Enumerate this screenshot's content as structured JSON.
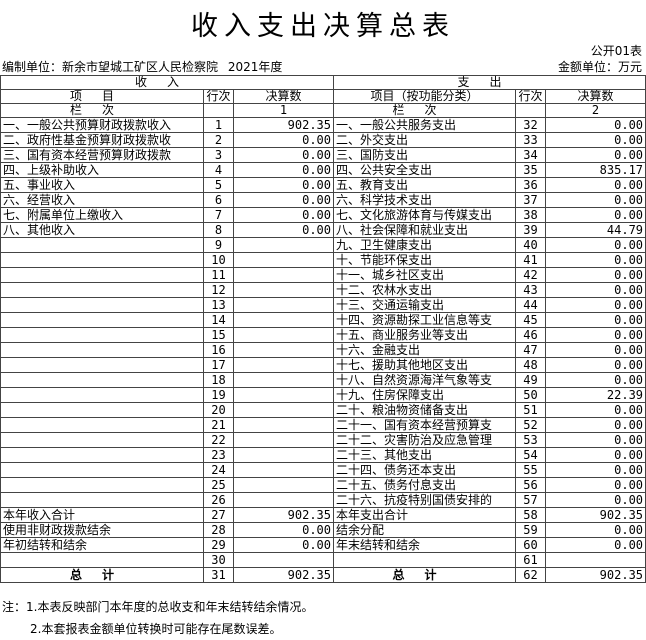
{
  "title": "收入支出决算总表",
  "form_code": "公开01表",
  "unit_label": "编制单位：新余市望城工矿区人民检察院",
  "year": "2021年度",
  "amount_unit": "金额单位：万元",
  "header": {
    "income_section": "收入",
    "expense_section": "支出",
    "item": "项目",
    "row_no": "行次",
    "amount": "决算数",
    "item_by_function": "项目（按功能分类）",
    "column": "栏次",
    "col1": "1",
    "col2": "2"
  },
  "rows": [
    {
      "l_item": "一、一般公共预算财政拨款收入",
      "l_no": "1",
      "l_amt": "902.35",
      "r_item": "一、一般公共服务支出",
      "r_no": "32",
      "r_amt": "0.00"
    },
    {
      "l_item": "二、政府性基金预算财政拨款收",
      "l_no": "2",
      "l_amt": "0.00",
      "r_item": "二、外交支出",
      "r_no": "33",
      "r_amt": "0.00"
    },
    {
      "l_item": "三、国有资本经营预算财政拨款",
      "l_no": "3",
      "l_amt": "0.00",
      "r_item": "三、国防支出",
      "r_no": "34",
      "r_amt": "0.00"
    },
    {
      "l_item": "四、上级补助收入",
      "l_no": "4",
      "l_amt": "0.00",
      "r_item": "四、公共安全支出",
      "r_no": "35",
      "r_amt": "835.17"
    },
    {
      "l_item": "五、事业收入",
      "l_no": "5",
      "l_amt": "0.00",
      "r_item": "五、教育支出",
      "r_no": "36",
      "r_amt": "0.00"
    },
    {
      "l_item": "六、经营收入",
      "l_no": "6",
      "l_amt": "0.00",
      "r_item": "六、科学技术支出",
      "r_no": "37",
      "r_amt": "0.00"
    },
    {
      "l_item": "七、附属单位上缴收入",
      "l_no": "7",
      "l_amt": "0.00",
      "r_item": "七、文化旅游体育与传媒支出",
      "r_no": "38",
      "r_amt": "0.00"
    },
    {
      "l_item": "八、其他收入",
      "l_no": "8",
      "l_amt": "0.00",
      "r_item": "八、社会保障和就业支出",
      "r_no": "39",
      "r_amt": "44.79"
    },
    {
      "l_item": "",
      "l_no": "9",
      "l_amt": "",
      "r_item": "九、卫生健康支出",
      "r_no": "40",
      "r_amt": "0.00"
    },
    {
      "l_item": "",
      "l_no": "10",
      "l_amt": "",
      "r_item": "十、节能环保支出",
      "r_no": "41",
      "r_amt": "0.00"
    },
    {
      "l_item": "",
      "l_no": "11",
      "l_amt": "",
      "r_item": "十一、城乡社区支出",
      "r_no": "42",
      "r_amt": "0.00"
    },
    {
      "l_item": "",
      "l_no": "12",
      "l_amt": "",
      "r_item": "十二、农林水支出",
      "r_no": "43",
      "r_amt": "0.00"
    },
    {
      "l_item": "",
      "l_no": "13",
      "l_amt": "",
      "r_item": "十三、交通运输支出",
      "r_no": "44",
      "r_amt": "0.00"
    },
    {
      "l_item": "",
      "l_no": "14",
      "l_amt": "",
      "r_item": "十四、资源勘探工业信息等支",
      "r_no": "45",
      "r_amt": "0.00"
    },
    {
      "l_item": "",
      "l_no": "15",
      "l_amt": "",
      "r_item": "十五、商业服务业等支出",
      "r_no": "46",
      "r_amt": "0.00"
    },
    {
      "l_item": "",
      "l_no": "16",
      "l_amt": "",
      "r_item": "十六、金融支出",
      "r_no": "47",
      "r_amt": "0.00"
    },
    {
      "l_item": "",
      "l_no": "17",
      "l_amt": "",
      "r_item": "十七、援助其他地区支出",
      "r_no": "48",
      "r_amt": "0.00"
    },
    {
      "l_item": "",
      "l_no": "18",
      "l_amt": "",
      "r_item": "十八、自然资源海洋气象等支",
      "r_no": "49",
      "r_amt": "0.00"
    },
    {
      "l_item": "",
      "l_no": "19",
      "l_amt": "",
      "r_item": "十九、住房保障支出",
      "r_no": "50",
      "r_amt": "22.39"
    },
    {
      "l_item": "",
      "l_no": "20",
      "l_amt": "",
      "r_item": "二十、粮油物资储备支出",
      "r_no": "51",
      "r_amt": "0.00"
    },
    {
      "l_item": "",
      "l_no": "21",
      "l_amt": "",
      "r_item": "二十一、国有资本经营预算支",
      "r_no": "52",
      "r_amt": "0.00"
    },
    {
      "l_item": "",
      "l_no": "22",
      "l_amt": "",
      "r_item": "二十二、灾害防治及应急管理",
      "r_no": "53",
      "r_amt": "0.00"
    },
    {
      "l_item": "",
      "l_no": "23",
      "l_amt": "",
      "r_item": "二十三、其他支出",
      "r_no": "54",
      "r_amt": "0.00"
    },
    {
      "l_item": "",
      "l_no": "24",
      "l_amt": "",
      "r_item": "二十四、债务还本支出",
      "r_no": "55",
      "r_amt": "0.00"
    },
    {
      "l_item": "",
      "l_no": "25",
      "l_amt": "",
      "r_item": "二十五、债务付息支出",
      "r_no": "56",
      "r_amt": "0.00"
    },
    {
      "l_item": "",
      "l_no": "26",
      "l_amt": "",
      "r_item": "二十六、抗疫特别国债安排的",
      "r_no": "57",
      "r_amt": "0.00"
    },
    {
      "l_item": "本年收入合计",
      "l_no": "27",
      "l_amt": "902.35",
      "r_item": "本年支出合计",
      "r_no": "58",
      "r_amt": "902.35"
    },
    {
      "l_item": "使用非财政拨款结余",
      "l_no": "28",
      "l_amt": "0.00",
      "r_item": "结余分配",
      "r_no": "59",
      "r_amt": "0.00",
      "indent": true
    },
    {
      "l_item": "年初结转和结余",
      "l_no": "29",
      "l_amt": "0.00",
      "r_item": "年末结转和结余",
      "r_no": "60",
      "r_amt": "0.00",
      "indent": true
    },
    {
      "l_item": "",
      "l_no": "30",
      "l_amt": "",
      "r_item": "",
      "r_no": "61",
      "r_amt": ""
    },
    {
      "l_item": "总计",
      "l_no": "31",
      "l_amt": "902.35",
      "r_item": "总计",
      "r_no": "62",
      "r_amt": "902.35",
      "total": true
    }
  ],
  "notes": [
    "注：1.本表反映部门本年度的总收支和年末结转结余情况。",
    "2.本套报表金额单位转换时可能存在尾数误差。"
  ]
}
